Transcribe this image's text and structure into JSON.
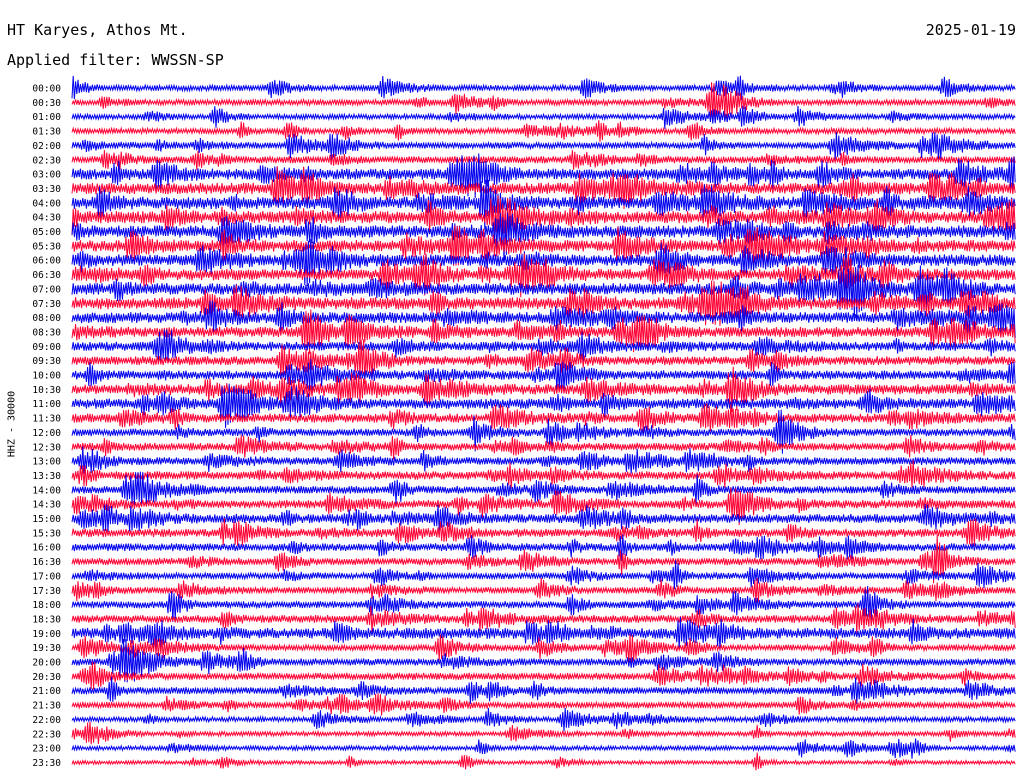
{
  "header": {
    "station": "HT Karyes, Athos Mt.",
    "filter": "Applied filter: WWSSN-SP",
    "date": "2025-01-19"
  },
  "colors": {
    "trace_a": "#0000ee",
    "trace_b": "#ff0033",
    "text": "#000000",
    "background": "#ffffff"
  },
  "chart_data": {
    "type": "line",
    "title": "",
    "ylabel": "HHZ - 30000",
    "xlabel": "",
    "grid": false,
    "legend": "none",
    "row_interval_minutes": 30,
    "series_colors": [
      "#0000ee",
      "#ff0033"
    ],
    "rows": [
      {
        "label": "00:00",
        "activity": 0.35
      },
      {
        "label": "00:30",
        "activity": 0.35
      },
      {
        "label": "01:00",
        "activity": 0.3
      },
      {
        "label": "01:30",
        "activity": 0.35
      },
      {
        "label": "02:00",
        "activity": 0.4
      },
      {
        "label": "02:30",
        "activity": 0.45
      },
      {
        "label": "03:00",
        "activity": 0.75
      },
      {
        "label": "03:30",
        "activity": 0.8
      },
      {
        "label": "04:00",
        "activity": 0.85
      },
      {
        "label": "04:30",
        "activity": 0.85
      },
      {
        "label": "05:00",
        "activity": 0.85
      },
      {
        "label": "05:30",
        "activity": 0.8
      },
      {
        "label": "06:00",
        "activity": 0.8
      },
      {
        "label": "06:30",
        "activity": 0.8
      },
      {
        "label": "07:00",
        "activity": 0.8
      },
      {
        "label": "07:30",
        "activity": 0.85
      },
      {
        "label": "08:00",
        "activity": 0.75
      },
      {
        "label": "08:30",
        "activity": 0.7
      },
      {
        "label": "09:00",
        "activity": 0.6
      },
      {
        "label": "09:30",
        "activity": 0.6
      },
      {
        "label": "10:00",
        "activity": 0.6
      },
      {
        "label": "10:30",
        "activity": 0.7
      },
      {
        "label": "11:00",
        "activity": 0.7
      },
      {
        "label": "11:30",
        "activity": 0.6
      },
      {
        "label": "12:00",
        "activity": 0.5
      },
      {
        "label": "12:30",
        "activity": 0.5
      },
      {
        "label": "13:00",
        "activity": 0.5
      },
      {
        "label": "13:30",
        "activity": 0.55
      },
      {
        "label": "14:00",
        "activity": 0.5
      },
      {
        "label": "14:30",
        "activity": 0.55
      },
      {
        "label": "15:00",
        "activity": 0.6
      },
      {
        "label": "15:30",
        "activity": 0.55
      },
      {
        "label": "16:00",
        "activity": 0.5
      },
      {
        "label": "16:30",
        "activity": 0.45
      },
      {
        "label": "17:00",
        "activity": 0.4
      },
      {
        "label": "17:30",
        "activity": 0.4
      },
      {
        "label": "18:00",
        "activity": 0.45
      },
      {
        "label": "18:30",
        "activity": 0.5
      },
      {
        "label": "19:00",
        "activity": 0.75
      },
      {
        "label": "19:30",
        "activity": 0.4
      },
      {
        "label": "20:00",
        "activity": 0.45
      },
      {
        "label": "20:30",
        "activity": 0.45
      },
      {
        "label": "21:00",
        "activity": 0.45
      },
      {
        "label": "21:30",
        "activity": 0.4
      },
      {
        "label": "22:00",
        "activity": 0.3
      },
      {
        "label": "22:30",
        "activity": 0.25
      },
      {
        "label": "23:00",
        "activity": 0.25
      },
      {
        "label": "23:30",
        "activity": 0.2
      }
    ]
  }
}
